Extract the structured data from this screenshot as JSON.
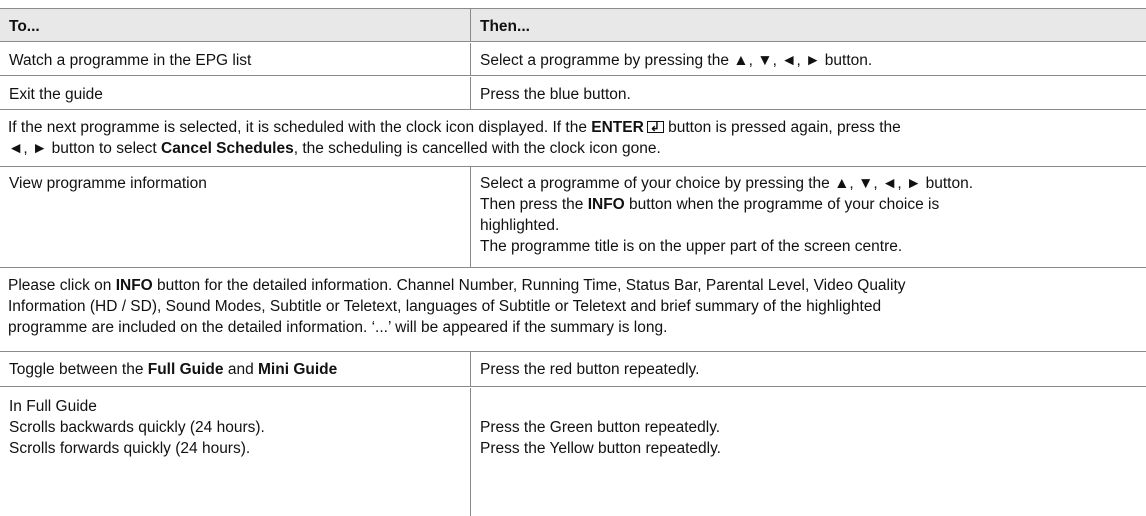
{
  "table1": {
    "header": {
      "col1": "To...",
      "col2": "Then..."
    },
    "rows": [
      {
        "to": "Watch a programme in the EPG list",
        "then": "Select a programme by pressing the ▲, ▼, ◄, ► button."
      },
      {
        "to": "Exit the guide",
        "then": "Press the blue button."
      }
    ]
  },
  "note1": {
    "part1": "If the next programme is selected, it is scheduled with the clock icon displayed. If the ",
    "enter": "ENTER",
    "part2": " button is pressed again, press the",
    "part3": "◄, ► button to select ",
    "cancel": "Cancel Schedules",
    "part4": ", the scheduling is cancelled with the clock icon gone."
  },
  "table2": {
    "to": "View programme information",
    "then_line1": "Select a programme of your choice by pressing the ▲, ▼, ◄, ► button.",
    "then_line2_a": "Then press the ",
    "then_line2_info": "INFO",
    "then_line2_b": " button when the programme of your choice is",
    "then_line3": "highlighted.",
    "then_line4": "The programme title is on the upper part of the screen centre."
  },
  "note2": {
    "a": "Please click on ",
    "info": "INFO",
    "b": " button for the detailed information. Channel Number, Running Time, Status Bar, Parental Level, Video Quality",
    "line2": "Information (HD / SD), Sound Modes, Subtitle or Teletext, languages of Subtitle or Teletext and brief summary of the highlighted",
    "line3": "programme are included on the detailed information. ‘...’ will be appeared if the summary is long."
  },
  "table3": {
    "toggle_a": "Toggle between the ",
    "toggle_full": "Full Guide",
    "toggle_and": " and ",
    "toggle_mini": "Mini Guide",
    "toggle_then": "Press the red button repeatedly.",
    "in_full": "In Full Guide",
    "back": "Scrolls backwards quickly (24 hours).",
    "back_then": "Press the Green button repeatedly.",
    "fwd": "Scrolls forwards quickly (24 hours).",
    "fwd_then": "Press the Yellow button repeatedly."
  }
}
